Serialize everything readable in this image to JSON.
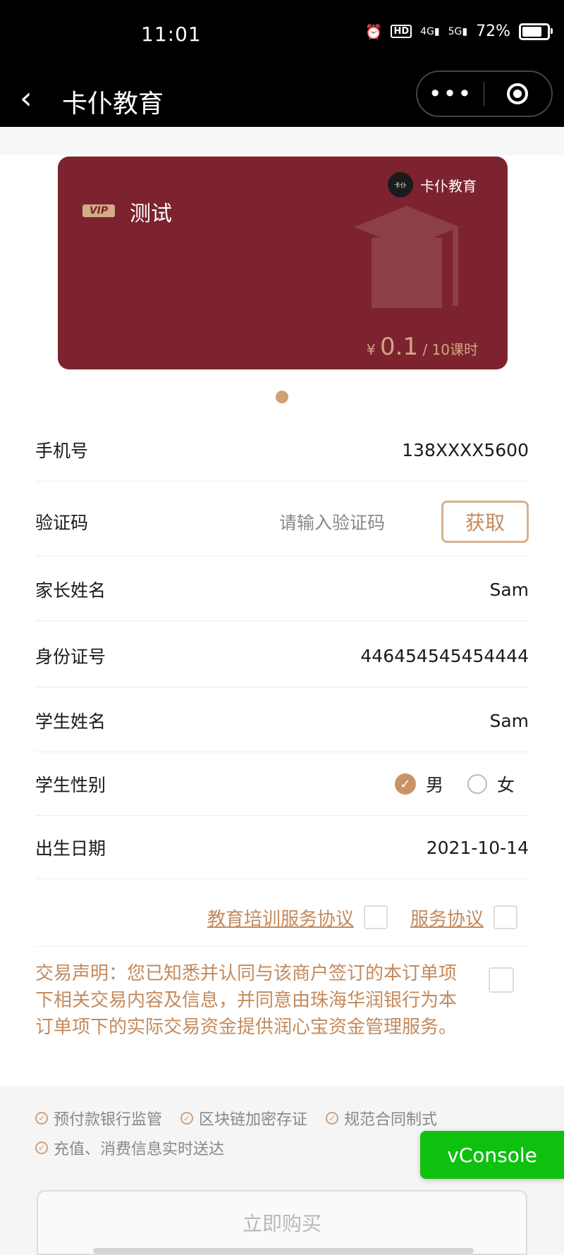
{
  "status_bar": {
    "time": "11:01",
    "battery": "72%",
    "battery_level": 0.72,
    "icons": [
      "alarm-icon",
      "hd-icon",
      "4g-icon",
      "5g-icon",
      "battery-icon"
    ]
  },
  "nav": {
    "title": "卡仆教育",
    "back_icon": "chevron-left-icon",
    "more_label": "•••"
  },
  "card": {
    "badge": "VIP",
    "name": "测试",
    "merchant": "卡仆教育",
    "merchant_logo_text": "卡仆",
    "currency": "¥",
    "price": "0.1",
    "unit": "/ 10课时",
    "bg_color": "#7c232f"
  },
  "form": {
    "phone_label": "手机号",
    "phone_value": "138XXXX5600",
    "code_label": "验证码",
    "code_placeholder": "请输入验证码",
    "get_code_label": "获取",
    "parent_name_label": "家长姓名",
    "parent_name_value": "Sam",
    "id_label": "身份证号",
    "id_value": "446454545454444",
    "student_name_label": "学生姓名",
    "student_name_value": "Sam",
    "gender_label": "学生性别",
    "gender_male": "男",
    "gender_female": "女",
    "gender_selected": "男",
    "birth_label": "出生日期",
    "birth_value": "2021-10-14"
  },
  "agreements": {
    "education_link": "教育培训服务协议",
    "service_link": "服务协议",
    "declaration": "交易声明：您已知悉并认同与该商户签订的本订单项下相关交易内容及信息，并同意由珠海华润银行为本订单项下的实际交易资金提供润心宝资金管理服务。"
  },
  "footer": {
    "tags": [
      "预付款银行监管",
      "区块链加密存证",
      "规范合同制式",
      "充值、消费信息实时送达"
    ],
    "buy_label": "立即购买",
    "vconsole_label": "vConsole",
    "accent_color": "#c48a5c"
  }
}
